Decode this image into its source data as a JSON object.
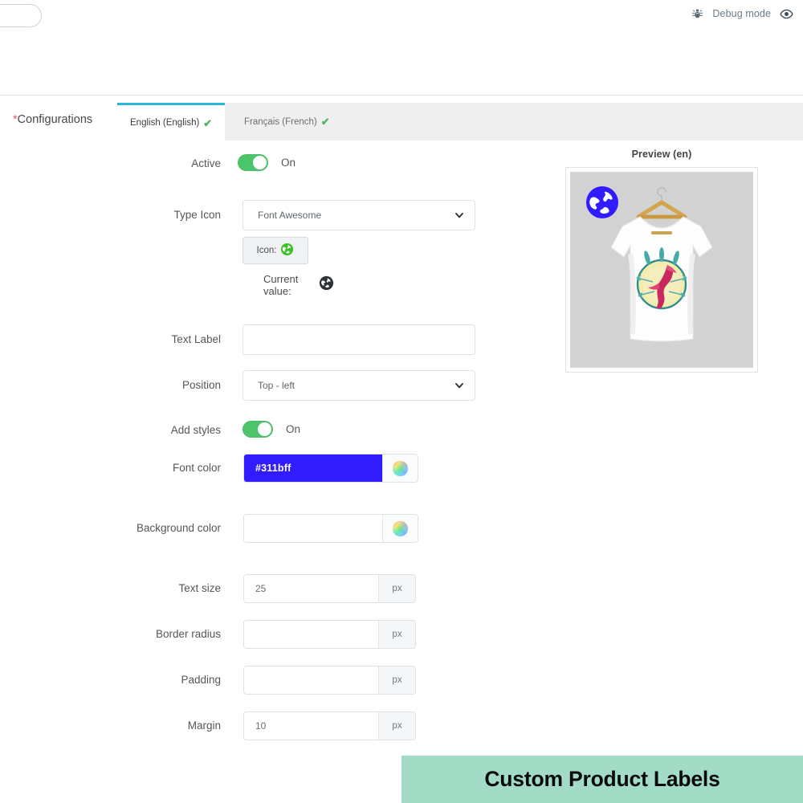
{
  "header": {
    "search_placeholder": "",
    "debug_label": "Debug mode",
    "bug_icon": "bug-icon",
    "eye_icon": "eye-icon"
  },
  "tabs_section": {
    "required_marker": "*",
    "section_label": "Configurations",
    "tabs": [
      {
        "label": "English (English)",
        "check": "✔",
        "active": true
      },
      {
        "label": "Français (French)",
        "check": "✔",
        "active": false
      }
    ]
  },
  "form": {
    "active": {
      "label": "Active",
      "state_text": "On",
      "on": true
    },
    "type_icon": {
      "label": "Type Icon",
      "value": "Font Awesome",
      "chevron_icon": "chevron-down-icon"
    },
    "icon_button": {
      "label": "Icon:",
      "icon": "globe-icon-green"
    },
    "current_value": {
      "label": "Current value:",
      "icon": "globe-icon-dark"
    },
    "text_label": {
      "label": "Text Label",
      "value": "",
      "placeholder": ""
    },
    "position": {
      "label": "Position",
      "value": "Top - left",
      "chevron_icon": "chevron-down-icon"
    },
    "add_styles": {
      "label": "Add styles",
      "state_text": "On",
      "on": true
    },
    "font_color": {
      "label": "Font color",
      "value": "#311bff",
      "swatch": "#311bff",
      "picker_icon": "color-wheel-icon"
    },
    "background_color": {
      "label": "Background color",
      "value": "",
      "swatch": "#ffffff",
      "picker_icon": "color-wheel-icon"
    },
    "text_size": {
      "label": "Text size",
      "value": "25",
      "unit": "px"
    },
    "border_radius": {
      "label": "Border radius",
      "value": "",
      "unit": "px"
    },
    "padding": {
      "label": "Padding",
      "value": "",
      "unit": "px"
    },
    "margin": {
      "label": "Margin",
      "value": "10",
      "unit": "px"
    }
  },
  "preview": {
    "title": "Preview (en)",
    "badge_icon": "globe-icon-blue",
    "badge_color": "#311bff",
    "product_image": "white-tshirt-on-hanger",
    "background": "#d2d2d2"
  },
  "banner": {
    "text": "Custom Product Labels",
    "background": "#a2dcc6"
  }
}
